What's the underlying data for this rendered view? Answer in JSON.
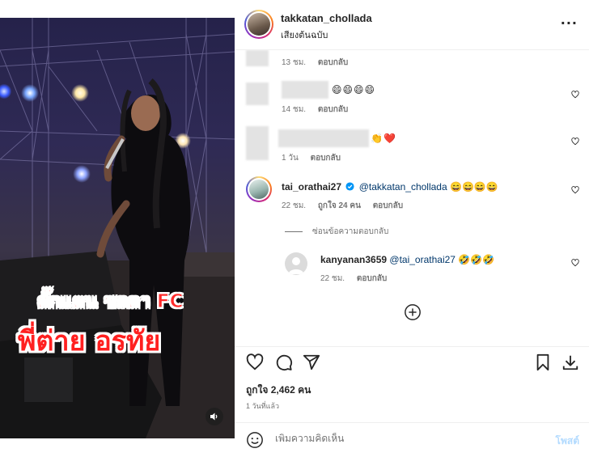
{
  "video": {
    "caption_line1": "ตั๊กแตน ชลดา FC",
    "caption_line2": "พี่ต่าย อรทัย",
    "mute_icon": "volume-icon"
  },
  "header": {
    "username": "takkatan_chollada",
    "audio": "เสียงต้นฉบับ",
    "more_icon": "more-options-icon"
  },
  "comments": [
    {
      "time": "13 ชม.",
      "reply_label": "ตอบกลับ"
    },
    {
      "emoji": "😄😄😄😄",
      "time": "14 ชม.",
      "reply_label": "ตอบกลับ"
    },
    {
      "emoji": "👏❤️",
      "time": "1 วัน",
      "reply_label": "ตอบกลับ"
    },
    {
      "username": "tai_orathai27",
      "verified": true,
      "mention": "@takkatan_chollada",
      "emoji": "😄😄😄😄",
      "time": "22 ชม.",
      "likes": "ถูกใจ 24 คน",
      "reply_label": "ตอบกลับ"
    }
  ],
  "hide_replies": "ซ่อนข้อความตอบกลับ",
  "reply": {
    "username": "kanyanan3659",
    "mention": "@tai_orathai27",
    "emoji": "🤣🤣🤣",
    "time": "22 ชม.",
    "reply_label": "ตอบกลับ"
  },
  "actions": {
    "likes": "ถูกใจ 2,462 คน",
    "posted": "1 วันที่แล้ว"
  },
  "composer": {
    "placeholder": "เพิ่มความคิดเห็น",
    "post_label": "โพสต์"
  },
  "colors": {
    "mention": "#00376b",
    "verified": "#0095f6",
    "post_disabled": "#b3dbff",
    "caption_red": "#ff2020"
  }
}
